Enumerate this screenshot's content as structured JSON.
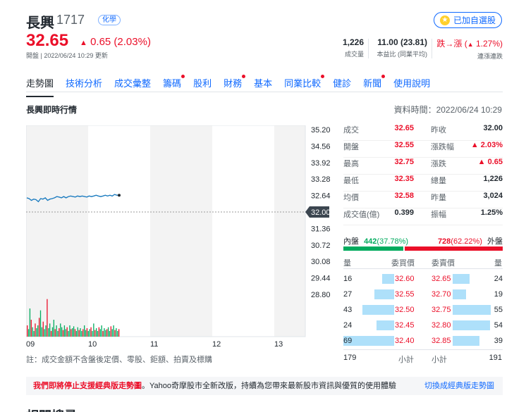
{
  "header": {
    "name": "長興",
    "code": "1717",
    "industry": "化學",
    "price": "32.65",
    "change": "0.65 (2.03%)",
    "open_time": "開盤 | 2022/06/24 10:29 更新",
    "watch_label": "已加自選股",
    "volume": {
      "value": "1,226",
      "label": "成交量"
    },
    "pe": {
      "value": "11.00 (23.81)",
      "label": "本益比 (同業平均)"
    },
    "streak": {
      "value_prefix": "跌→漲 (",
      "value_pct": "1.27%)",
      "label": "連漲連跌"
    }
  },
  "tabs": [
    {
      "label": "走勢圖",
      "active": true,
      "dot": false
    },
    {
      "label": "技術分析",
      "dot": false
    },
    {
      "label": "成交彙整",
      "dot": false
    },
    {
      "label": "籌碼",
      "dot": true
    },
    {
      "label": "股利",
      "dot": false
    },
    {
      "label": "財務",
      "dot": true
    },
    {
      "label": "基本",
      "dot": false
    },
    {
      "label": "同業比較",
      "dot": true
    },
    {
      "label": "健診",
      "dot": false
    },
    {
      "label": "新聞",
      "dot": true
    },
    {
      "label": "使用說明",
      "dot": false
    }
  ],
  "section_title": "長興即時行情",
  "data_time": "資料時間：2022/06/24 10:29",
  "chart_data": {
    "type": "line",
    "y_ticks": [
      "35.20",
      "34.56",
      "33.92",
      "33.28",
      "32.64",
      "32.00",
      "31.36",
      "30.72",
      "30.08",
      "29.44",
      "28.80"
    ],
    "x_ticks": [
      "09",
      "10",
      "11",
      "12",
      "13"
    ],
    "ref_price": "32.00",
    "ylim": [
      28.8,
      35.2
    ],
    "price": [
      32.55,
      32.52,
      32.45,
      32.5,
      32.48,
      32.4,
      32.52,
      32.5,
      32.55,
      32.45,
      32.5,
      32.52,
      32.55,
      32.6,
      32.58,
      32.55,
      32.6,
      32.55,
      32.6,
      32.62,
      32.6,
      32.58,
      32.62,
      32.6,
      32.62,
      32.6,
      32.58,
      32.62,
      32.6,
      32.62,
      32.65,
      32.62,
      32.6,
      32.62,
      32.65,
      32.62,
      32.65,
      32.62,
      32.68,
      32.65,
      32.65
    ],
    "volume": [
      12,
      8,
      30,
      18,
      10,
      6,
      14,
      9,
      12,
      20,
      28,
      10,
      16,
      8,
      12,
      40,
      9,
      14,
      6,
      10,
      18,
      8,
      12,
      6,
      9,
      14,
      10,
      7,
      12,
      8,
      10,
      6,
      12,
      8,
      9,
      11,
      8,
      6,
      10,
      7,
      9,
      6,
      8,
      12,
      7,
      9,
      6,
      8,
      10,
      6,
      14,
      7,
      9,
      6,
      10,
      8,
      12,
      6,
      9,
      7,
      8,
      10,
      6,
      11,
      8,
      12,
      7,
      9,
      6,
      8
    ]
  },
  "quote": [
    {
      "l1": "成交",
      "v1": "32.65",
      "c1": "red",
      "l2": "昨收",
      "v2": "32.00",
      "c2": ""
    },
    {
      "l1": "開盤",
      "v1": "32.55",
      "c1": "red",
      "l2": "漲跌幅",
      "v2": "▲ 2.03%",
      "c2": "red"
    },
    {
      "l1": "最高",
      "v1": "32.75",
      "c1": "red",
      "l2": "漲跌",
      "v2": "▲ 0.65",
      "c2": "red"
    },
    {
      "l1": "最低",
      "v1": "32.35",
      "c1": "red",
      "l2": "總量",
      "v2": "1,226",
      "c2": ""
    },
    {
      "l1": "均價",
      "v1": "32.58",
      "c1": "red",
      "l2": "昨量",
      "v2": "3,024",
      "c2": ""
    },
    {
      "l1": "成交值(億)",
      "v1": "0.399",
      "c1": "",
      "l2": "振幅",
      "v2": "1.25%",
      "c2": ""
    }
  ],
  "inout": {
    "in_label": "內盤",
    "in_value": "442",
    "in_pct": "(37.78%)",
    "in_fraction": 0.3778,
    "out_value": "728",
    "out_pct": "(62.22%)",
    "out_label": "外盤"
  },
  "orderbook": {
    "headers": {
      "bid_qty": "量",
      "bid_price": "委買價",
      "ask_price": "委賣價",
      "ask_qty": "量"
    },
    "rows": [
      {
        "bq": "16",
        "bp": "32.60",
        "ap": "32.65",
        "aq": "24",
        "bf": 0.23,
        "af": 0.44
      },
      {
        "bq": "27",
        "bp": "32.55",
        "ap": "32.70",
        "aq": "19",
        "bf": 0.39,
        "af": 0.35
      },
      {
        "bq": "43",
        "bp": "32.50",
        "ap": "32.75",
        "aq": "55",
        "bf": 0.62,
        "af": 1.0
      },
      {
        "bq": "24",
        "bp": "32.45",
        "ap": "32.80",
        "aq": "54",
        "bf": 0.35,
        "af": 0.98
      },
      {
        "bq": "69",
        "bp": "32.40",
        "ap": "32.85",
        "aq": "39",
        "bf": 1.0,
        "af": 0.71
      }
    ],
    "total_bid": "179",
    "subtotal_label": "小計",
    "subtotal_label2": "小計",
    "total_ask": "191"
  },
  "footnote": "註：成交金額不含盤後定價、零股、鉅額、拍賣及標購",
  "notice": {
    "highlight": "我們即將停止支援經典版走勢圖",
    "text": "。Yahoo奇摩股市全新改版，持續為您帶來最新股市資訊與優質的使用體驗",
    "link": "切換成經典版走勢圖"
  },
  "bottom_heading": "相關搜尋"
}
